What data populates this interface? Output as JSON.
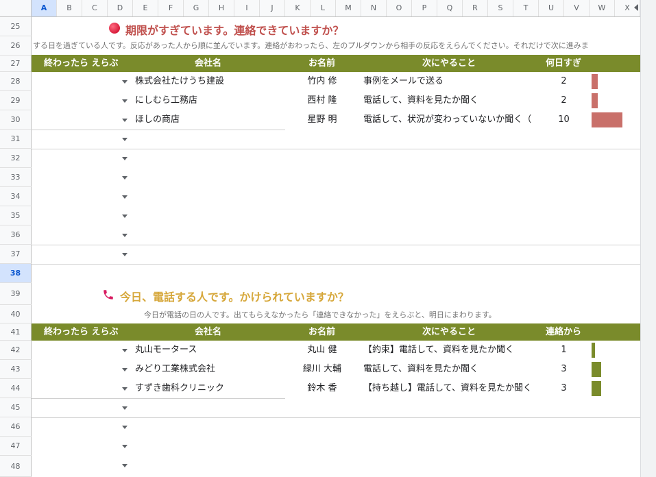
{
  "columns": [
    "A",
    "B",
    "C",
    "D",
    "E",
    "F",
    "G",
    "H",
    "I",
    "J",
    "K",
    "L",
    "M",
    "N",
    "O",
    "P",
    "Q",
    "R",
    "S",
    "T",
    "U",
    "V",
    "W",
    "X"
  ],
  "rows": [
    "25",
    "26",
    "27",
    "28",
    "29",
    "30",
    "31",
    "32",
    "33",
    "34",
    "35",
    "36",
    "37",
    "38",
    "39",
    "40",
    "41",
    "42",
    "43",
    "44",
    "45",
    "46",
    "47",
    "48"
  ],
  "overdue": {
    "title": "期限がすぎています。連絡できていますか？",
    "subtitle": "する日を過ぎている人です。反応があった人から順に並んでいます。連絡がおわったら、左のプルダウンから相手の反応をえらんでください。それだけで次に進みま",
    "headers": {
      "select": "終わったら えらぶ",
      "company": "会社名",
      "name": "お名前",
      "next": "次にやること",
      "metric": "何日すぎ"
    },
    "rows": [
      {
        "company": "株式会社たけうち建設",
        "name": "竹内 修",
        "next": "事例をメールで送る",
        "value": "2",
        "num": 2
      },
      {
        "company": "にしむら工務店",
        "name": "西村 隆",
        "next": "電話して、資料を見たか聞く",
        "value": "2",
        "num": 2
      },
      {
        "company": "ほしの商店",
        "name": "星野 明",
        "next": "電話して、状況が変わっていないか聞く（",
        "value": "10",
        "num": 10
      }
    ],
    "bar_max": 10,
    "bar_color": "#c9706a"
  },
  "today": {
    "title": "今日、電話する人です。かけられていますか？",
    "subtitle": "今日が電話の日の人です。出てもらえなかったら「連絡できなかった」をえらぶと、明日にまわります。",
    "headers": {
      "select": "終わったら えらぶ",
      "company": "会社名",
      "name": "お名前",
      "next": "次にやること",
      "metric": "連絡から"
    },
    "rows": [
      {
        "company": "丸山モータース",
        "name": "丸山 健",
        "next": "【約束】電話して、資料を見たか聞く",
        "value": "1",
        "num": 1
      },
      {
        "company": "みどり工業株式会社",
        "name": "緑川 大輔",
        "next": "電話して、資料を見たか聞く",
        "value": "3",
        "num": 3
      },
      {
        "company": "すずき歯科クリニック",
        "name": "鈴木 香",
        "next": "【持ち越し】電話して、資料を見たか聞く",
        "value": "3",
        "num": 3
      }
    ],
    "bar_max": 10,
    "bar_color": "#7a8b2b"
  },
  "icons": {
    "overdue": "red-circle-icon",
    "today": "telephone-icon",
    "dropdown": "chevron-down-icon",
    "scroll": "scroll-left-icon"
  },
  "colors": {
    "header_green": "#7a8b2b",
    "title_red": "#c0504d",
    "title_gold": "#d6a73a",
    "active_blue": "#d3e3fd"
  }
}
